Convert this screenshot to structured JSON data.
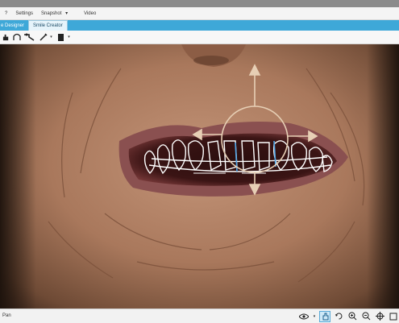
{
  "menu": {
    "items": [
      {
        "label": "?",
        "name": "menu-help"
      },
      {
        "label": "Settings",
        "name": "menu-settings"
      },
      {
        "label": "Snapshot",
        "name": "menu-snapshot",
        "has_dropdown": true
      },
      {
        "label": "Video",
        "name": "menu-video"
      }
    ]
  },
  "tabs": [
    {
      "label": "e Designer",
      "name": "tab-smile-designer",
      "active": false
    },
    {
      "label": "Smile Creator",
      "name": "tab-smile-creator",
      "active": true
    }
  ],
  "toolbar": {
    "icons": [
      "pan-hand-icon",
      "lasso-curve-icon",
      "pointer-tool-icon",
      "pen-icon",
      "color-swatch-icon"
    ]
  },
  "status": {
    "text": "Pan"
  },
  "view_tools": {
    "icons": [
      "eye-icon",
      "pan-tool-icon",
      "rotate-tool-icon",
      "zoom-in-icon",
      "zoom-out-icon",
      "fit-view-icon",
      "fullscreen-icon"
    ]
  },
  "colors": {
    "accent": "#3ea8d8",
    "overlay_lines": "#ffffff",
    "highlight_lines": "#4fa4e6",
    "manipulator": "#e7cfb5"
  }
}
